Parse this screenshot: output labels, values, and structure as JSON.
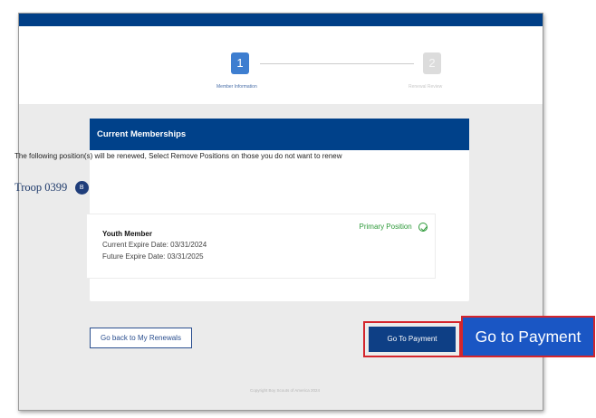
{
  "stepper": {
    "steps": [
      {
        "number": "1",
        "label": "Member Information",
        "state": "active"
      },
      {
        "number": "2",
        "label": "Renewal Review",
        "state": "inactive"
      }
    ]
  },
  "card": {
    "title": "Current Memberships",
    "description": "The following position(s) will be renewed, Select Remove Positions on those you do not want to renew",
    "troop": {
      "name": "Troop 0399",
      "badge": "B"
    }
  },
  "membership": {
    "role": "Youth Member",
    "current_expire": "Current Expire Date: 03/31/2024",
    "future_expire": "Future Expire Date: 03/31/2025",
    "primary_label": "Primary Position"
  },
  "actions": {
    "back_label": "Go back to My Renewals",
    "pay_label": "Go To Payment"
  },
  "footer": {
    "copyright": "Copyright Boy Scouts of America 2024"
  },
  "callout": {
    "text": "Go to Payment"
  },
  "colors": {
    "brand_navy": "#003f87",
    "step_active": "#3e7ed0",
    "primary_green": "#2e9a3a",
    "highlight_red": "#d4252c",
    "callout_blue": "#1a56c4"
  }
}
